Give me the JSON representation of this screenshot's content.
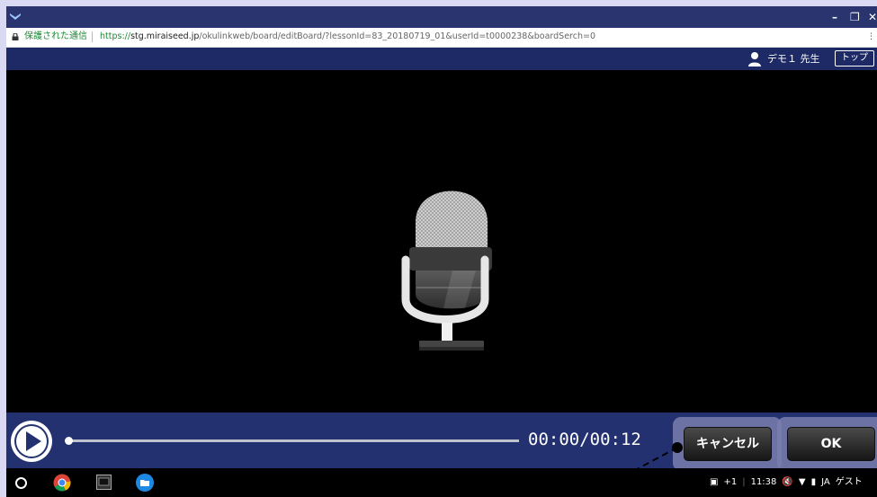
{
  "window": {
    "minimize_glyph": "–",
    "restore_glyph": "❐",
    "close_glyph": "✕"
  },
  "addressbar": {
    "secure_label": "保護された通信",
    "url_protocol": "https://",
    "url_host": "stg.miraiseed.jp",
    "url_path": "/okulinkweb/board/editBoard/?lessonId=83_20180719_01&userId=t0000238&boardSerch=0",
    "menu_glyph": "⋮"
  },
  "header": {
    "user_name": "デモ１ 先生",
    "top_label": "トップ"
  },
  "player": {
    "time": "00:00/00:12",
    "progress": 0.0,
    "cancel_label": "キャンセル",
    "ok_label": "OK"
  },
  "taskbar": {
    "tray_notifications": "+1",
    "clock": "11:38",
    "ime": "JA",
    "user": "ゲスト"
  },
  "colors": {
    "titlebar": "#2a3570",
    "header": "#1d2a66",
    "controlbar": "#243170",
    "secure_green": "#1a8a33",
    "highlight": "#7a7eae"
  },
  "icons": [
    "app-logo-icon",
    "lock-icon",
    "user-icon",
    "microphone-icon",
    "play-icon",
    "launcher-icon",
    "chrome-icon",
    "screen-app-icon",
    "files-icon",
    "image-icon",
    "mute-icon",
    "wifi-icon",
    "battery-icon"
  ]
}
